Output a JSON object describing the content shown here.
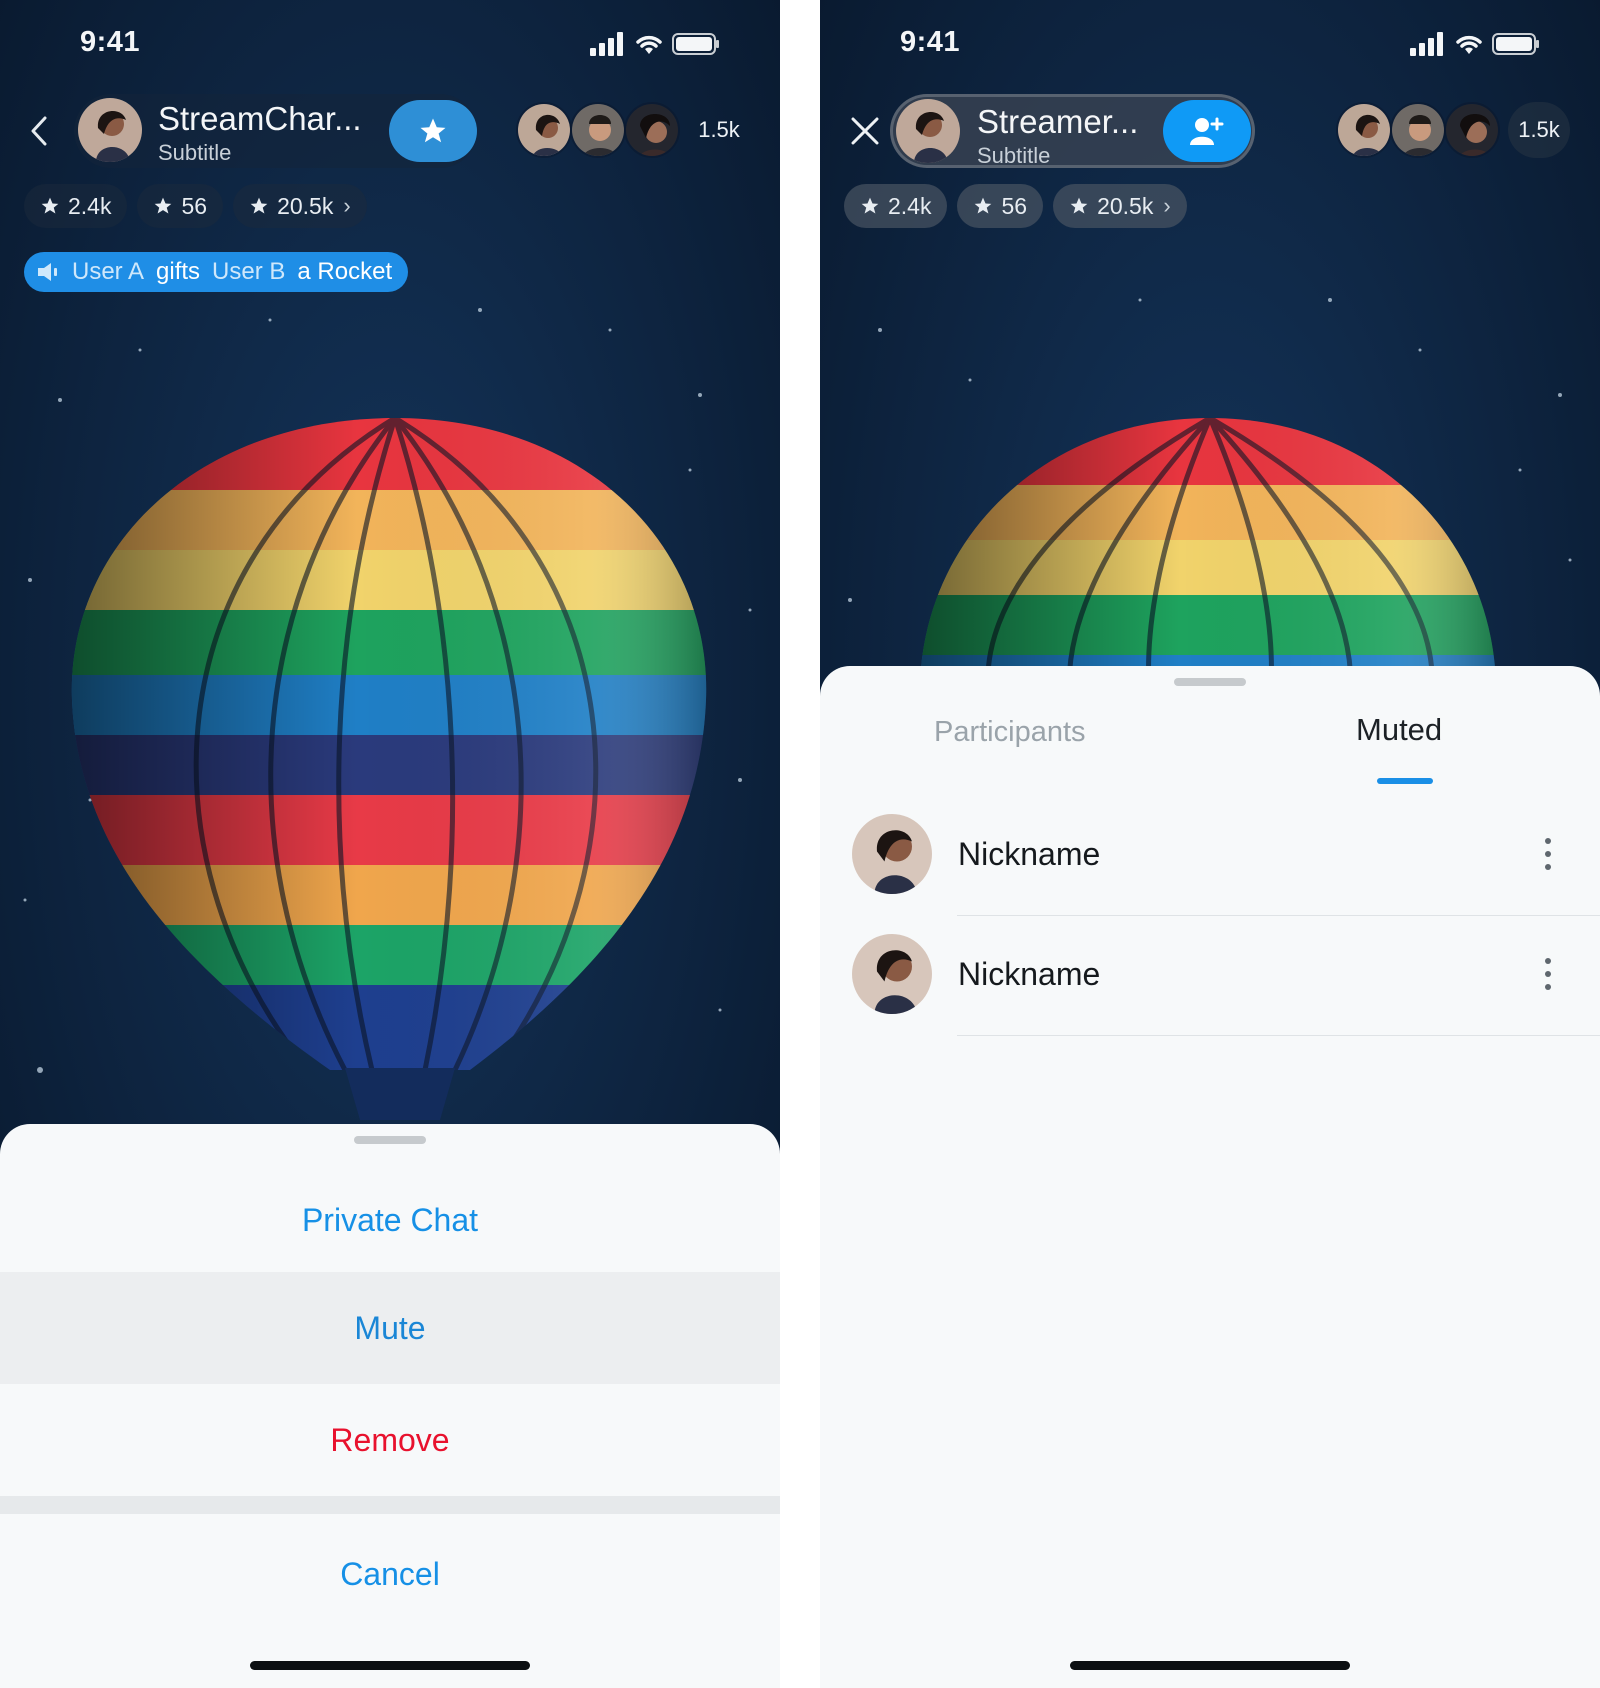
{
  "status": {
    "time": "9:41"
  },
  "left_screen": {
    "streamer_name": "StreamChar...",
    "streamer_subtitle": "Subtitle",
    "action_icon": "star-icon",
    "viewer_count": "1.5k",
    "stats": [
      {
        "icon": "star-icon",
        "value": "2.4k"
      },
      {
        "icon": "star-icon",
        "value": "56"
      },
      {
        "icon": "star-icon",
        "value": "20.5k"
      }
    ],
    "gift_banner": {
      "icon": "speaker-icon",
      "parts": [
        "User A",
        "gifts",
        "User B",
        "a Rocket"
      ]
    },
    "action_sheet": {
      "items": [
        "Private Chat",
        "Mute",
        "Remove"
      ],
      "cancel_label": "Cancel"
    }
  },
  "right_screen": {
    "streamer_name": "Streamer...",
    "streamer_subtitle": "Subtitle",
    "action_icon": "add-user-icon",
    "viewer_count": "1.5k",
    "stats": [
      {
        "icon": "star-icon",
        "value": "2.4k"
      },
      {
        "icon": "star-icon",
        "value": "56"
      },
      {
        "icon": "star-icon",
        "value": "20.5k"
      }
    ],
    "tabs": [
      {
        "label": "Participants",
        "active": false
      },
      {
        "label": "Muted",
        "active": true
      }
    ],
    "members": [
      {
        "nickname": "Nickname"
      },
      {
        "nickname": "Nickname"
      }
    ]
  },
  "colors": {
    "accent": "#1690e6",
    "destructive": "#e8112d",
    "night_sky": "#0c1f38",
    "sheet_background": "#f7f9fa"
  }
}
